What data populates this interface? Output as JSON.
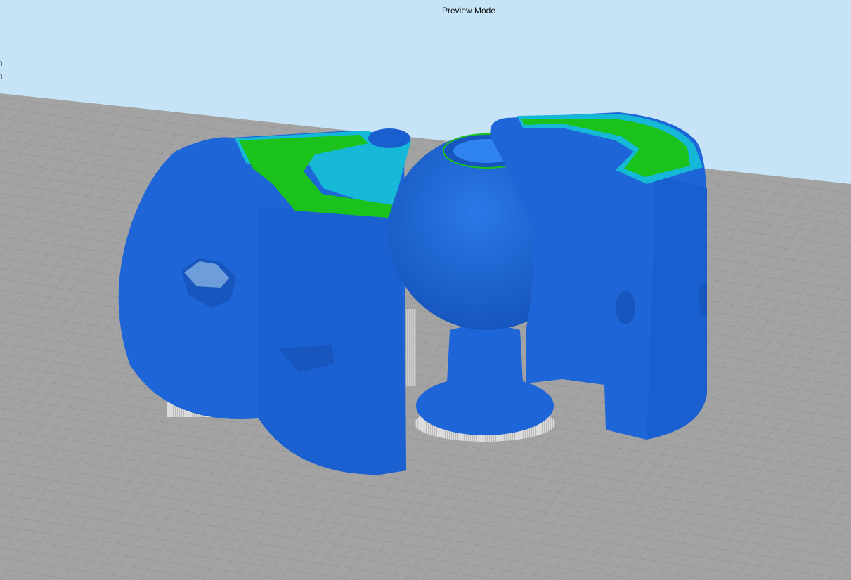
{
  "header": {
    "mode_label": "Preview Mode"
  },
  "left_panel": {
    "items": [
      {
        "label": "on"
      },
      {
        "label": "on"
      }
    ]
  },
  "colors": {
    "sky": "#c6e3f7",
    "bed": "#a3a3a3",
    "grid_line": "#8c8c8c",
    "wall": "#1e66d8",
    "wall_dark": "#1656be",
    "infill": "#1cc21c",
    "skin": "#19c6e0",
    "support": "#cfcfcf"
  }
}
